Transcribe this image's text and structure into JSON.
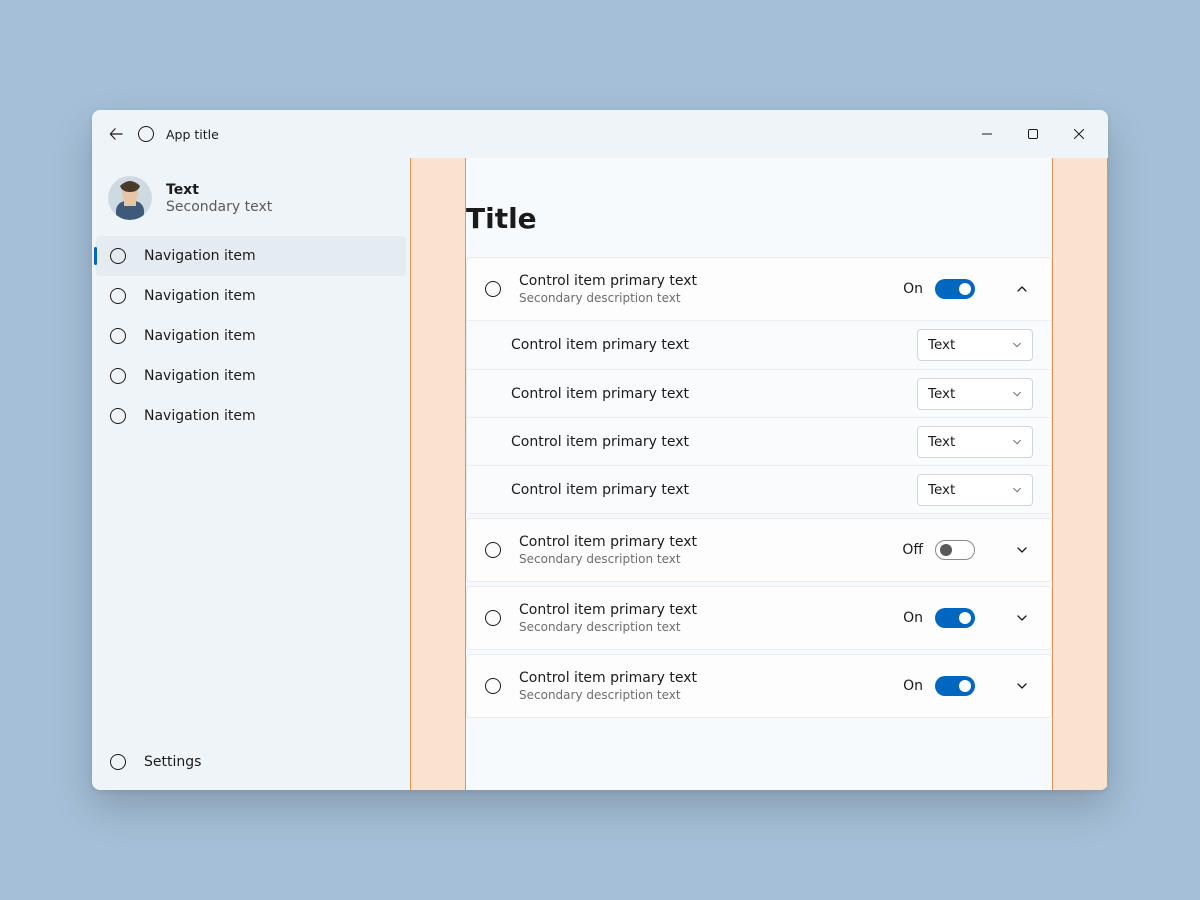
{
  "titlebar": {
    "app_title": "App title"
  },
  "profile": {
    "primary": "Text",
    "secondary": "Secondary text"
  },
  "nav": {
    "items": [
      {
        "label": "Navigation item",
        "selected": true
      },
      {
        "label": "Navigation item",
        "selected": false
      },
      {
        "label": "Navigation item",
        "selected": false
      },
      {
        "label": "Navigation item",
        "selected": false
      },
      {
        "label": "Navigation item",
        "selected": false
      }
    ],
    "footer": {
      "label": "Settings"
    }
  },
  "page": {
    "title": "Title",
    "groups": [
      {
        "primary": "Control item primary text",
        "secondary": "Secondary description text",
        "toggle_state": "on",
        "toggle_label": "On",
        "expanded": true,
        "children": [
          {
            "primary": "Control item primary text",
            "combo": "Text"
          },
          {
            "primary": "Control item primary text",
            "combo": "Text"
          },
          {
            "primary": "Control item primary text",
            "combo": "Text"
          },
          {
            "primary": "Control item primary text",
            "combo": "Text"
          }
        ]
      },
      {
        "primary": "Control item primary text",
        "secondary": "Secondary description text",
        "toggle_state": "off",
        "toggle_label": "Off",
        "expanded": false
      },
      {
        "primary": "Control item primary text",
        "secondary": "Secondary description text",
        "toggle_state": "on",
        "toggle_label": "On",
        "expanded": false
      },
      {
        "primary": "Control item primary text",
        "secondary": "Secondary description text",
        "toggle_state": "on",
        "toggle_label": "On",
        "expanded": false
      }
    ]
  }
}
